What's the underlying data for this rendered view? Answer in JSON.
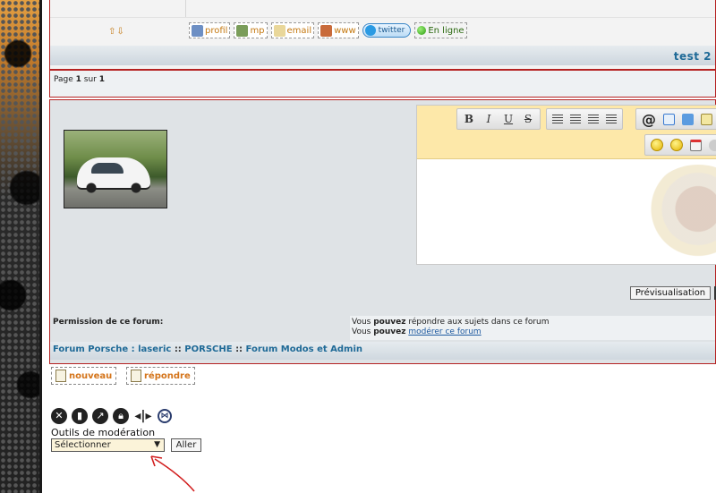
{
  "post": {
    "arrows": "⇧⇩",
    "buttons": [
      "profil",
      "mp",
      "email",
      "www"
    ],
    "twitter": "twitter",
    "online": "En ligne",
    "title": "test 2"
  },
  "pagination": {
    "prefix": "Page ",
    "current": "1",
    "middle": " sur ",
    "total": "1"
  },
  "editor": {
    "format_buttons": [
      "B",
      "I",
      "U",
      "S"
    ],
    "at_symbol": "@",
    "preview_label": "Prévisualisation"
  },
  "permissions": {
    "label": "Permission de ce forum:",
    "line1_prefix": "Vous ",
    "line1_bold": "pouvez",
    "line1_suffix": " répondre aux sujets dans ce forum",
    "line2_prefix": "Vous ",
    "line2_bold": "pouvez",
    "line2_link": "modérer ce forum"
  },
  "breadcrumb": {
    "items": [
      "Forum Porsche : laseric",
      "PORSCHE",
      "Forum Modos et Admin"
    ],
    "separator": "::"
  },
  "actions": {
    "new_topic": "nouveau",
    "reply": "répondre"
  },
  "moderation": {
    "title": "Outils de modération",
    "selected": "Sélectionner",
    "go_label": "Aller",
    "icons": [
      "delete-icon",
      "trash-icon",
      "move-icon",
      "lock-icon",
      "split-icon",
      "merge-icon"
    ]
  },
  "colors": {
    "panel_border": "#b52222",
    "link_blue": "#1f6a97",
    "button_orange": "#d4741a",
    "editor_toolbar": "#fde8a9"
  }
}
